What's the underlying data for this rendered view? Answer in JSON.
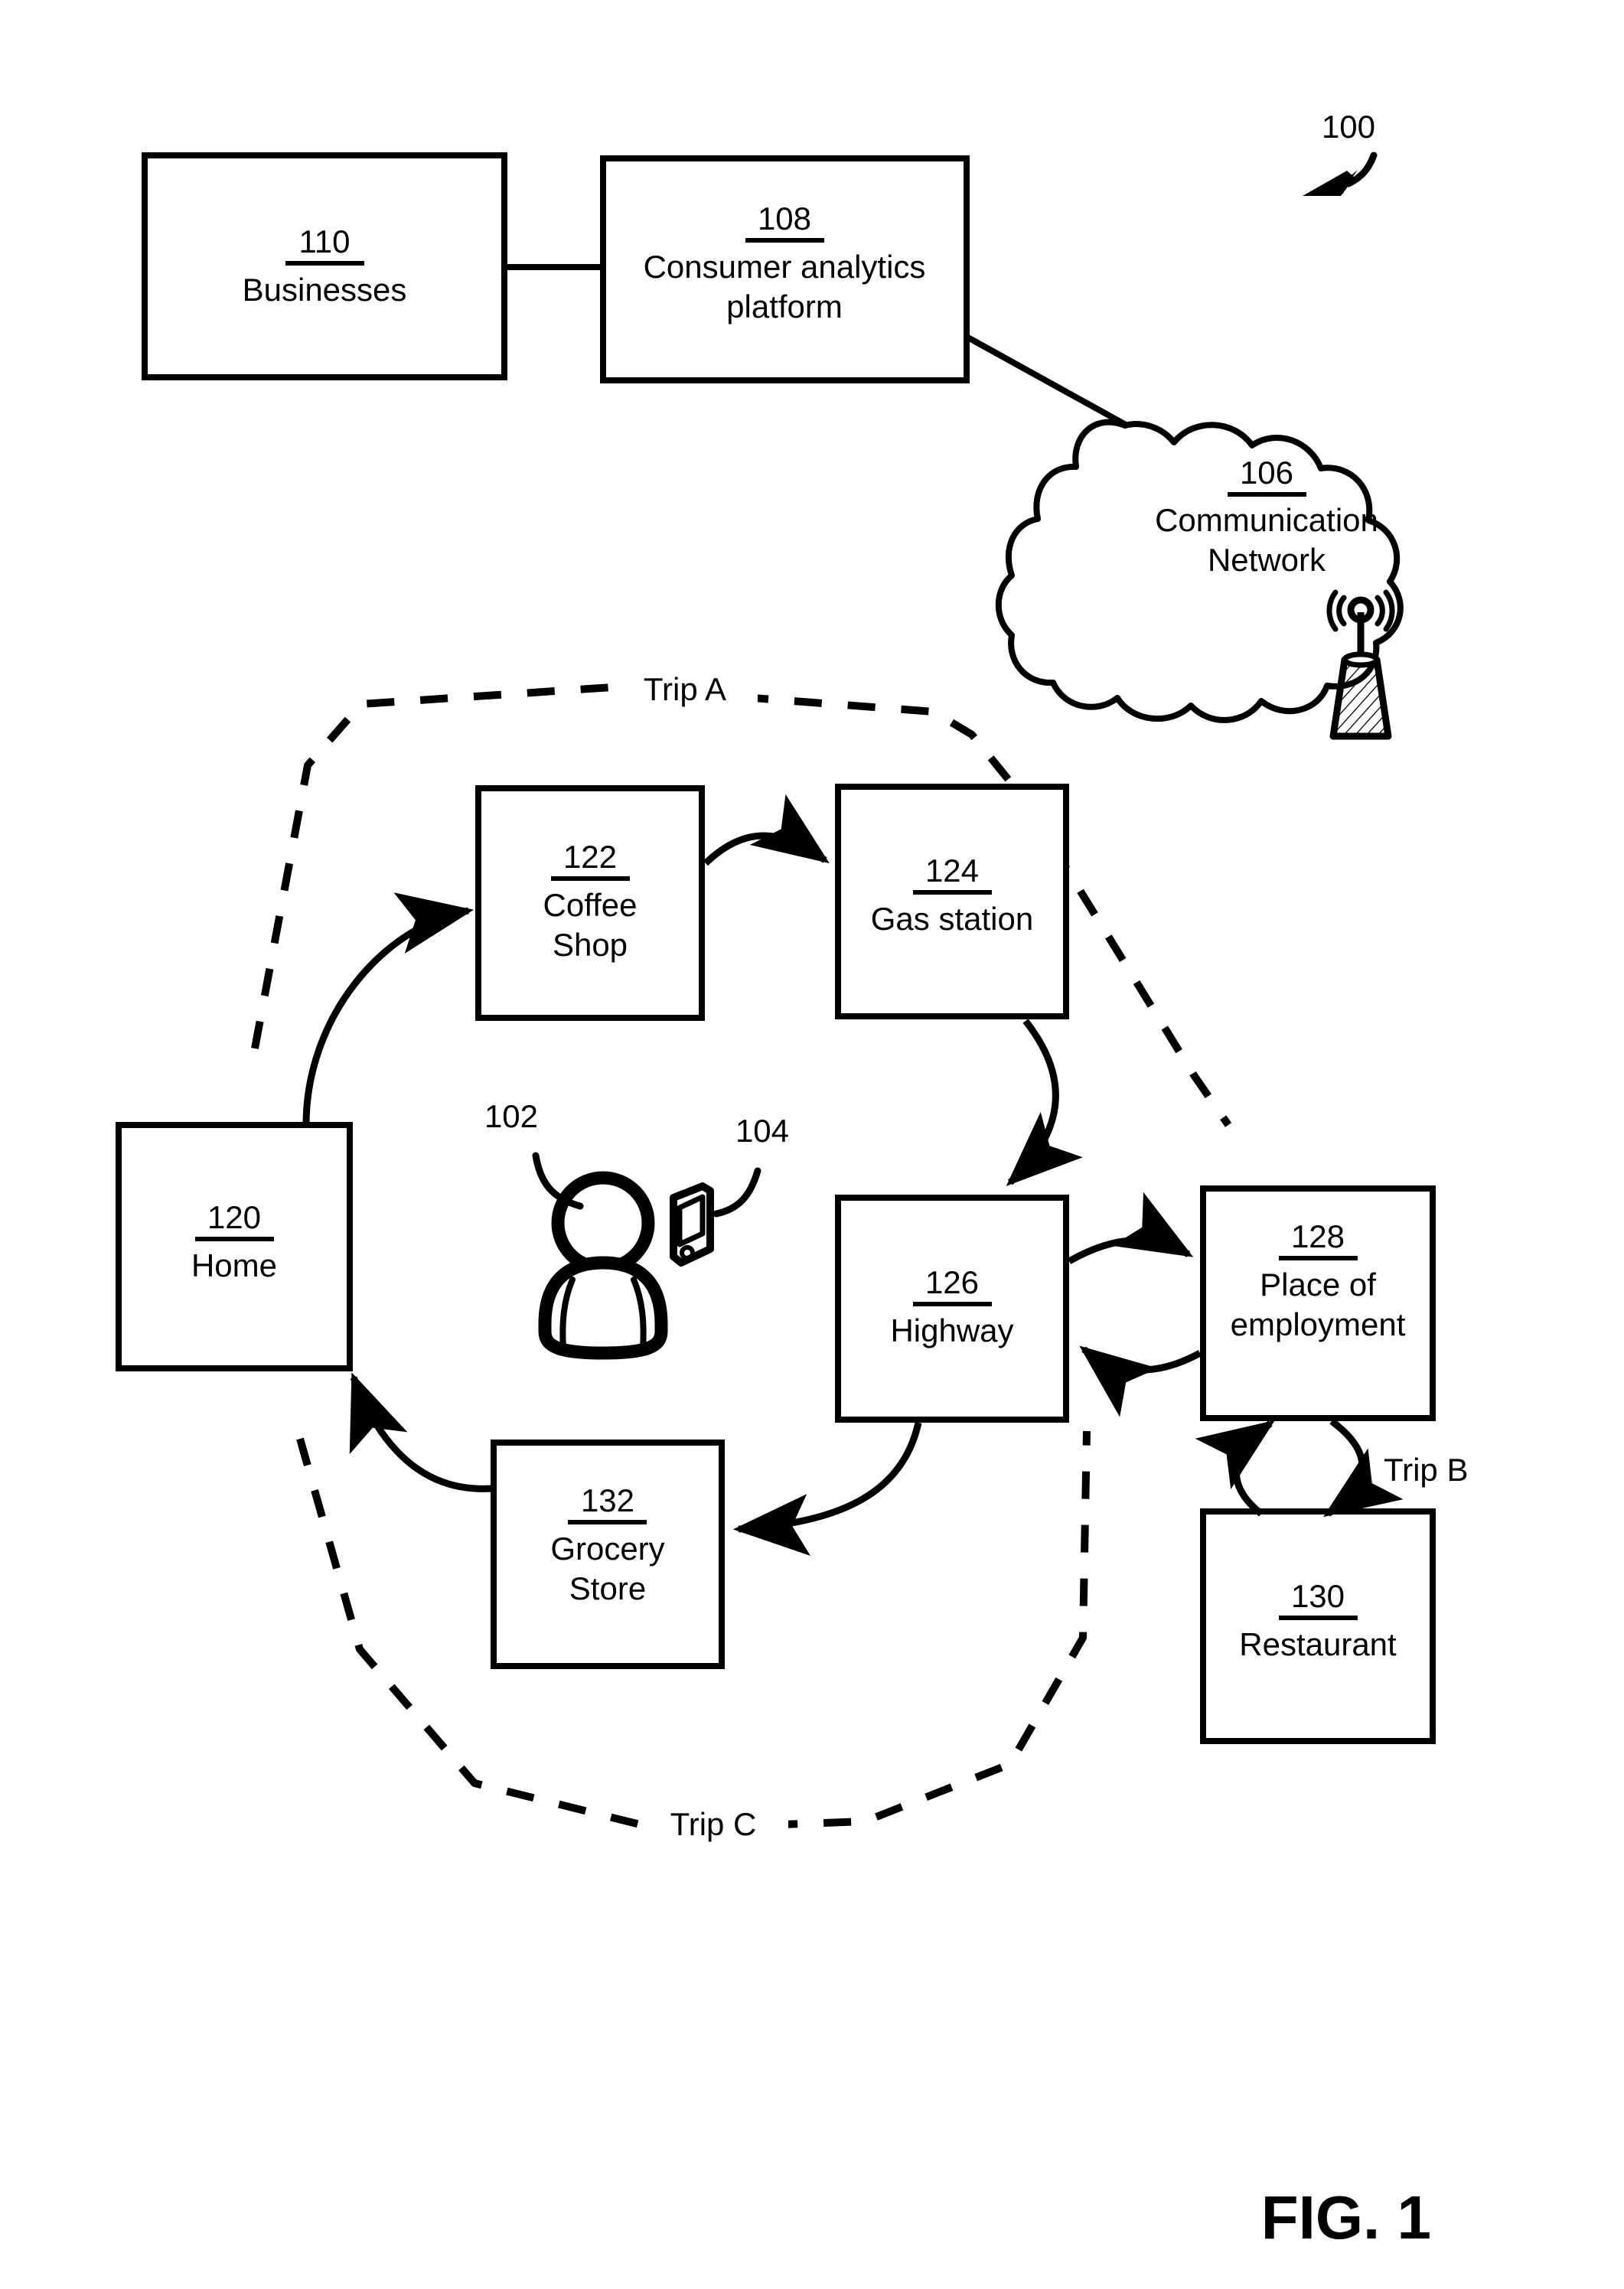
{
  "figure": {
    "caption": "FIG. 1",
    "system_ref": "100"
  },
  "nodes": {
    "businesses": {
      "ref": "110",
      "label": "Businesses",
      "shape": "rect"
    },
    "analytics": {
      "ref": "108",
      "label_line1": "Consumer analytics",
      "label_line2": "platform",
      "shape": "rect"
    },
    "network": {
      "ref": "106",
      "label_line1": "Communication",
      "label_line2": "Network",
      "shape": "cloud"
    },
    "home": {
      "ref": "120",
      "label": "Home",
      "shape": "rect"
    },
    "coffee_shop": {
      "ref": "122",
      "label_line1": "Coffee",
      "label_line2": "Shop",
      "shape": "rect"
    },
    "gas_station": {
      "ref": "124",
      "label": "Gas station",
      "shape": "rect"
    },
    "highway": {
      "ref": "126",
      "label": "Highway",
      "shape": "rect"
    },
    "place_of_employment": {
      "ref": "128",
      "label_line1": "Place of",
      "label_line2": "employment",
      "shape": "rect"
    },
    "restaurant": {
      "ref": "130",
      "label": "Restaurant",
      "shape": "rect"
    },
    "grocery_store": {
      "ref": "132",
      "label_line1": "Grocery",
      "label_line2": "Store",
      "shape": "rect"
    }
  },
  "callouts": {
    "consumer": {
      "ref": "102",
      "icon": "person-icon"
    },
    "mobile_device": {
      "ref": "104",
      "icon": "mobile-device-icon"
    },
    "cell_tower": {
      "icon": "cell-tower-icon"
    }
  },
  "trips": {
    "a": "Trip A",
    "b": "Trip B",
    "c": "Trip C"
  },
  "colors": {
    "stroke": "#000000",
    "background": "#ffffff"
  }
}
